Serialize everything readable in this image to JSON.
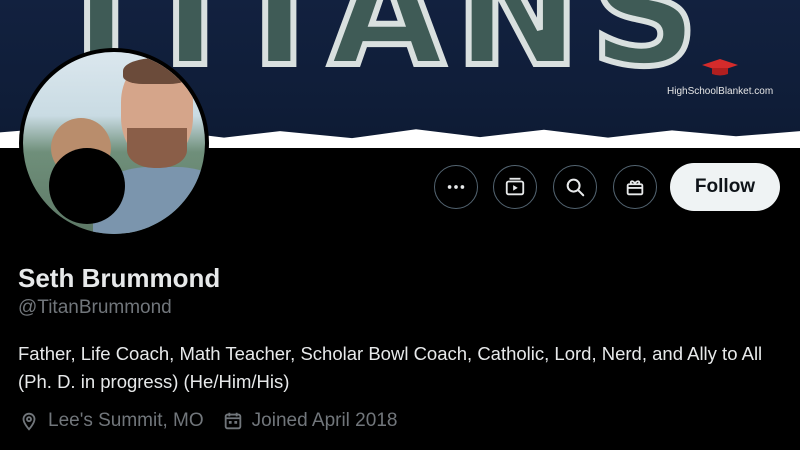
{
  "banner": {
    "word": "TITANS",
    "watermark": "HighSchoolBlanket.com"
  },
  "actions": {
    "more_icon": "more-dots-icon",
    "media_icon": "media-icon",
    "search_icon": "search-icon",
    "gift_icon": "gift-icon",
    "follow_label": "Follow"
  },
  "profile": {
    "name": "Seth Brummond",
    "handle": "@TitanBrummond",
    "bio": "Father, Life Coach, Math Teacher, Scholar Bowl Coach, Catholic, Lord, Nerd, and Ally to All (Ph. D. in progress) (He/Him/His)",
    "location": "Lee's Summit, MO",
    "joined": "Joined April 2018"
  },
  "colors": {
    "background": "#000000",
    "text": "#e7e9ea",
    "muted": "#71767b",
    "button_border": "#536471",
    "follow_bg": "#eff3f4"
  }
}
